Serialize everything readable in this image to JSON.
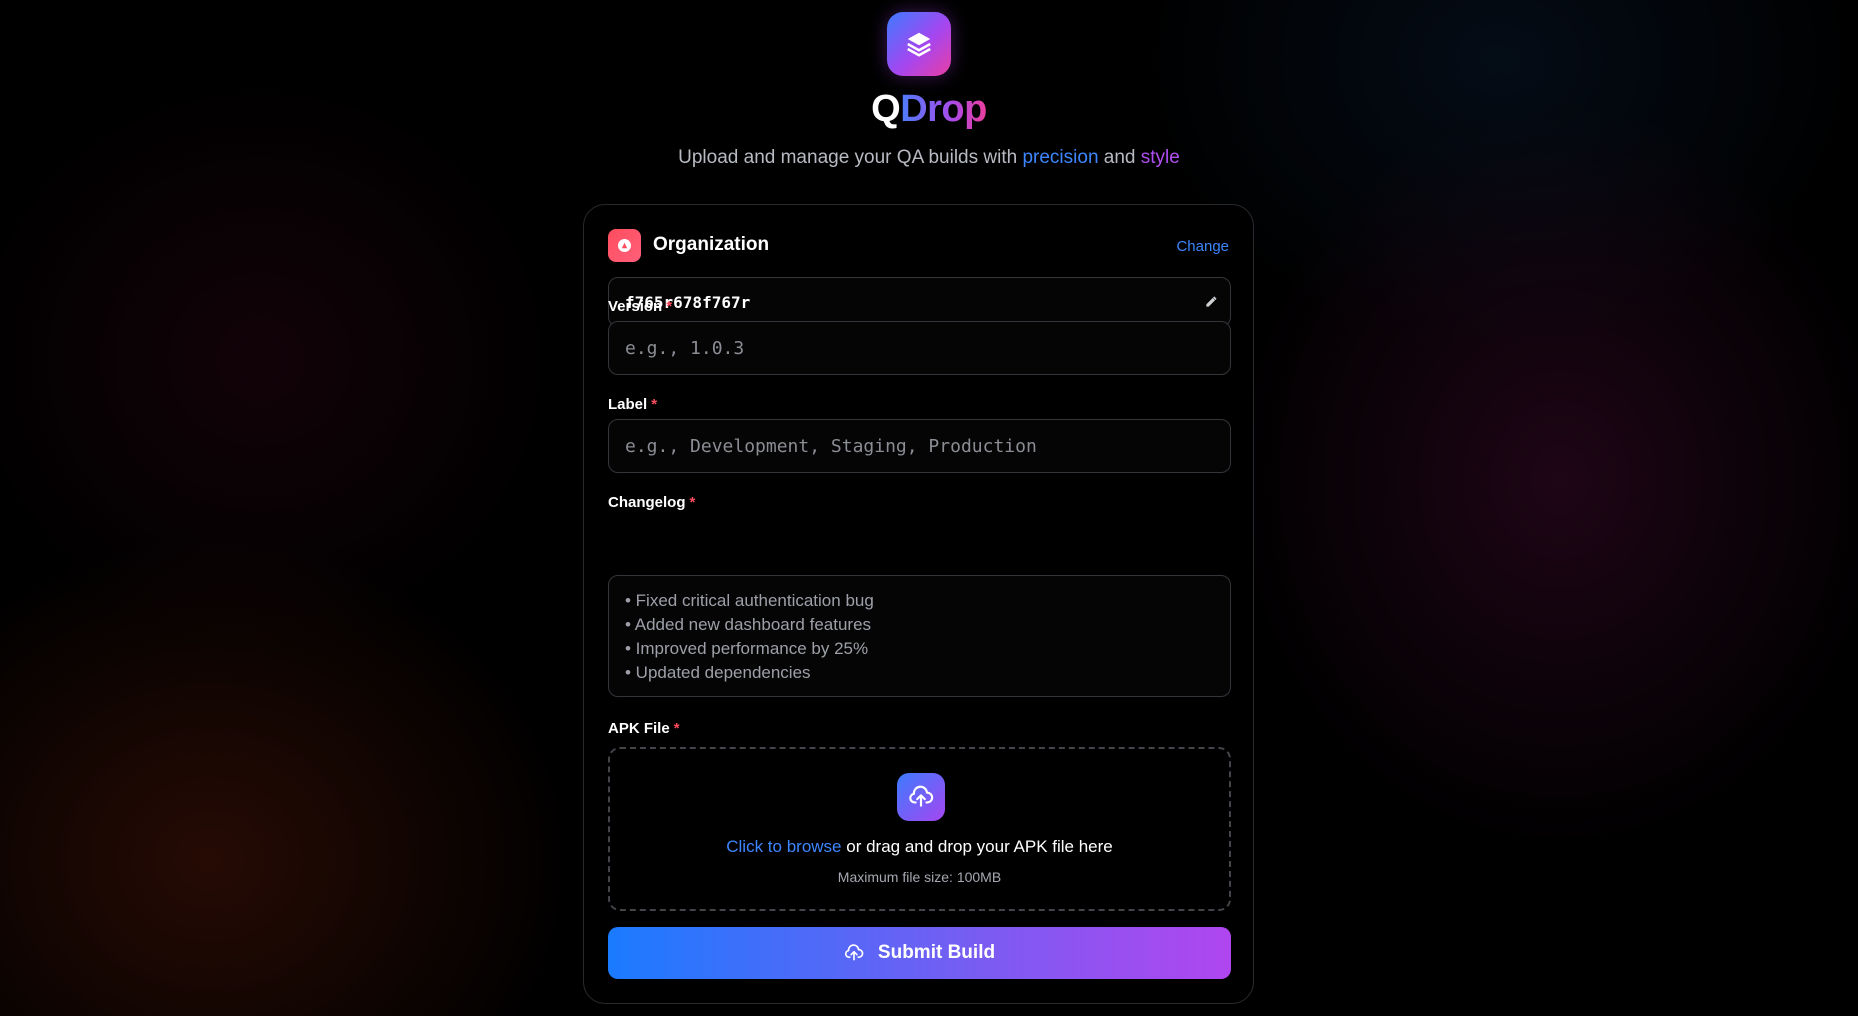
{
  "brand": {
    "logo_icon": "layers-icon",
    "title_first": "Q",
    "title_rest": "Drop",
    "subtitle_pre": "Upload and manage your QA builds with ",
    "subtitle_hl1": "precision",
    "subtitle_mid": " and ",
    "subtitle_hl2": "style"
  },
  "organization": {
    "label": "Organization",
    "change_label": "Change",
    "value": "f765r678f767r",
    "edit_icon": "pencil-icon"
  },
  "form": {
    "version": {
      "label": "Version",
      "required": "*",
      "placeholder": "e.g., 1.0.3"
    },
    "label_field": {
      "label": "Label",
      "required": "*",
      "placeholder": "e.g., Development, Staging, Production"
    },
    "changelog": {
      "label": "Changelog",
      "required": "*",
      "placeholder_lines": [
        "• Fixed critical authentication bug",
        "• Added new dashboard features",
        "• Improved performance by 25%",
        "• Updated dependencies"
      ]
    },
    "apk": {
      "label": "APK File",
      "required": "*",
      "browse": "Click to browse",
      "drop_text": " or drag and drop your APK file here",
      "max_size": "Maximum file size: 100MB",
      "icon": "cloud-upload-icon"
    },
    "submit_label": "Submit Build"
  },
  "colors": {
    "accent_blue": "#3d86ff",
    "accent_purple": "#b04ef2",
    "accent_pink": "#ec3e9c",
    "required_red": "#ff4d5e"
  }
}
